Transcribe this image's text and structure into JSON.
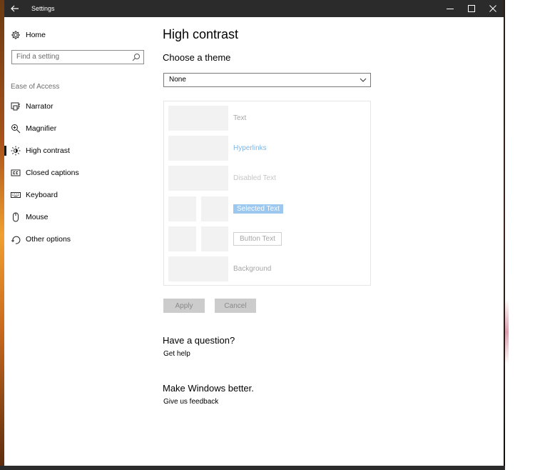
{
  "window": {
    "title": "Settings",
    "controls": {
      "minimize": "minimize",
      "maximize": "maximize",
      "close": "close"
    }
  },
  "sidebar": {
    "home_label": "Home",
    "search_placeholder": "Find a setting",
    "section_label": "Ease of Access",
    "items": [
      {
        "label": "Narrator",
        "icon": "narrator-icon"
      },
      {
        "label": "Magnifier",
        "icon": "magnifier-icon"
      },
      {
        "label": "High contrast",
        "icon": "high-contrast-icon",
        "active": true
      },
      {
        "label": "Closed captions",
        "icon": "closed-captions-icon"
      },
      {
        "label": "Keyboard",
        "icon": "keyboard-icon"
      },
      {
        "label": "Mouse",
        "icon": "mouse-icon"
      },
      {
        "label": "Other options",
        "icon": "other-options-icon"
      }
    ]
  },
  "main": {
    "title": "High contrast",
    "subtitle": "Choose a theme",
    "theme_select": {
      "value": "None"
    },
    "preview": {
      "text": "Text",
      "hyperlinks": "Hyperlinks",
      "disabled_text": "Disabled Text",
      "selected_text": "Selected Text",
      "button_text": "Button Text",
      "background": "Background"
    },
    "apply_label": "Apply",
    "cancel_label": "Cancel",
    "question_title": "Have a question?",
    "question_link": "Get help",
    "feedback_title": "Make Windows better.",
    "feedback_link": "Give us feedback"
  },
  "colors": {
    "titlebar": "#2b2b2b",
    "hyperlink_preview": "#7fb6e6",
    "selected_preview": "#9cc7ee",
    "button_disabled": "#cccccc"
  }
}
